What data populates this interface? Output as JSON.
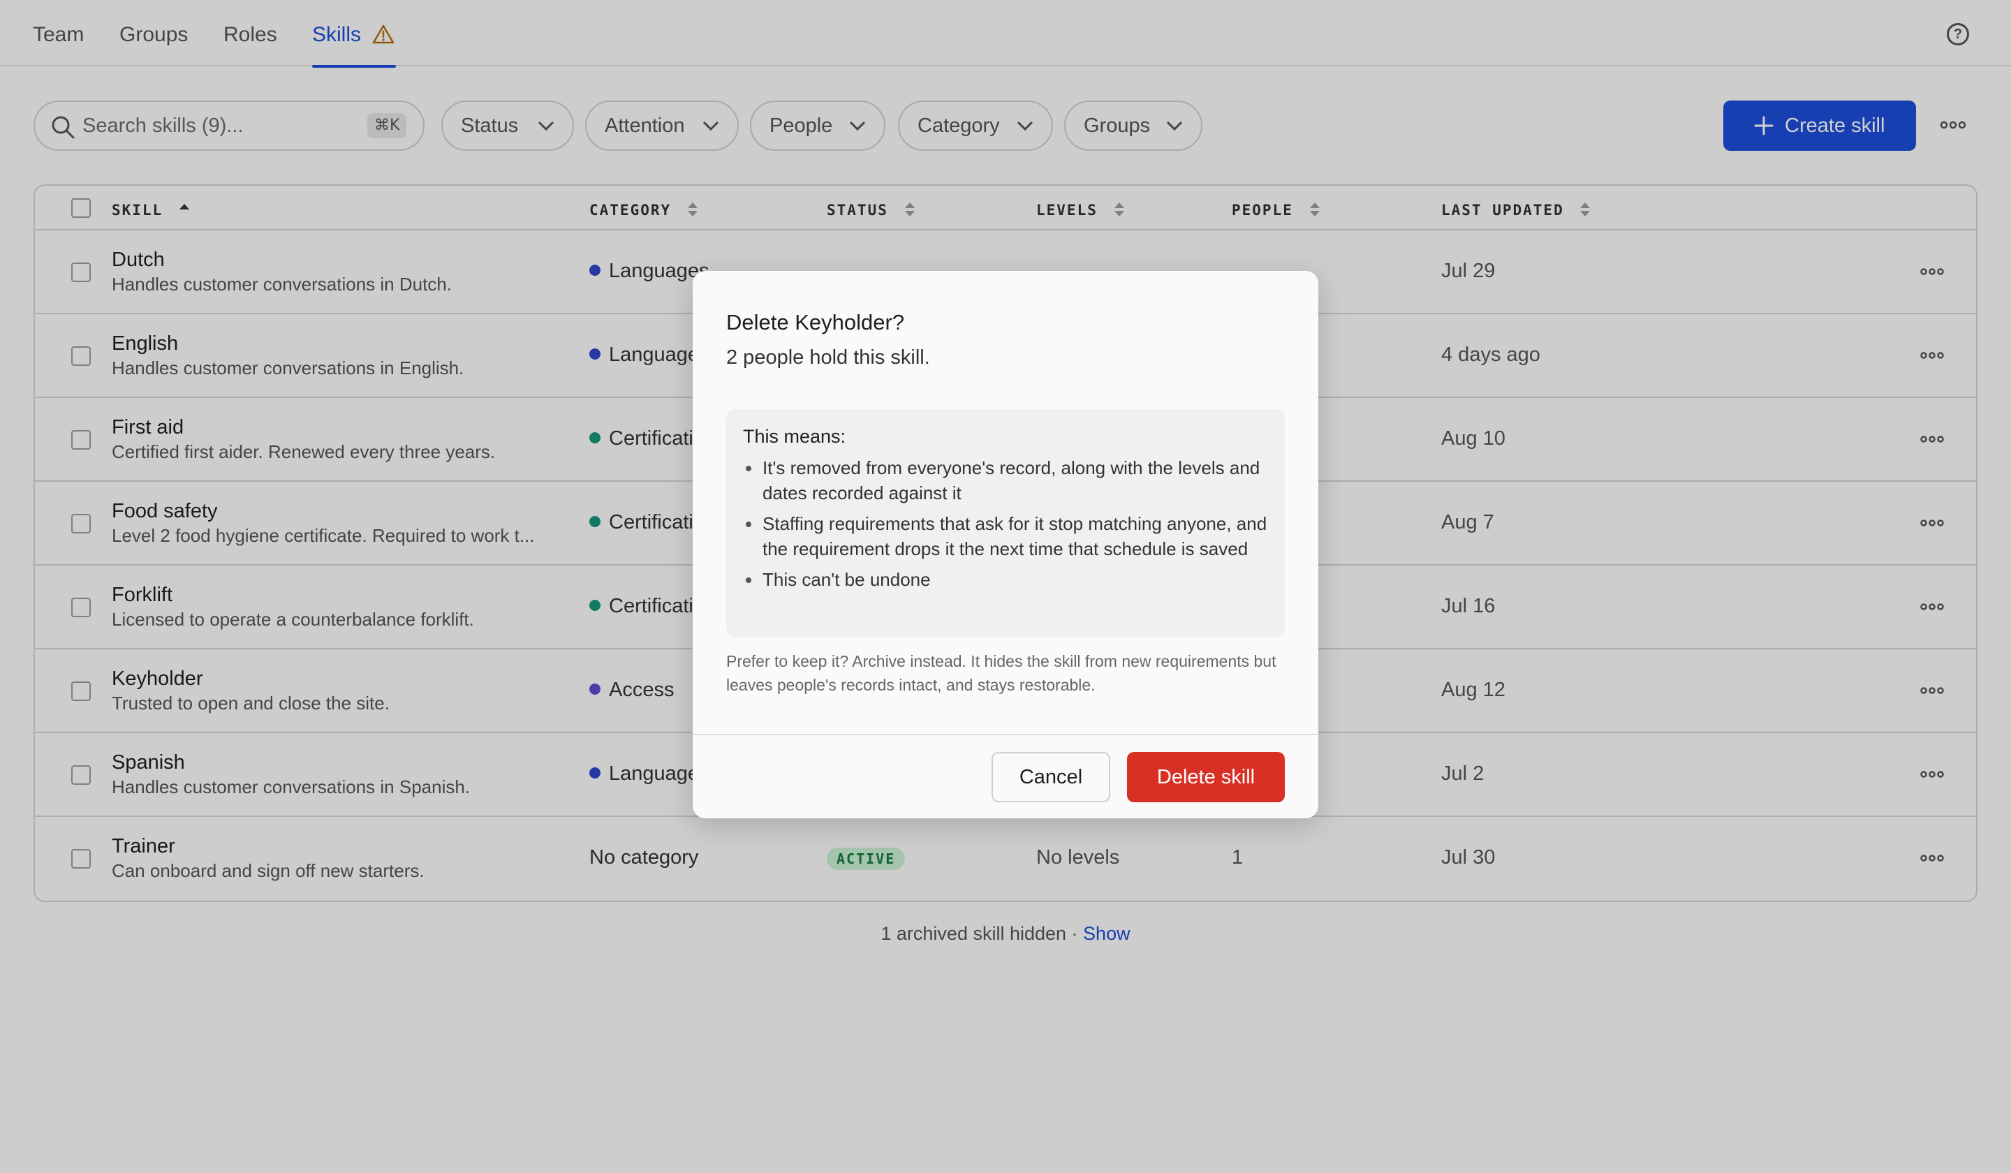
{
  "nav": {
    "tabs": [
      {
        "label": "Team"
      },
      {
        "label": "Groups"
      },
      {
        "label": "Roles"
      },
      {
        "label": "Skills"
      }
    ]
  },
  "toolbar": {
    "search_placeholder": "Search skills (9)...",
    "search_shortcut": "⌘K",
    "filters": [
      "Status",
      "Attention",
      "People",
      "Category",
      "Groups"
    ],
    "create_label": "Create skill"
  },
  "table": {
    "headers": {
      "skill": "SKILL",
      "category": "CATEGORY",
      "status": "STATUS",
      "levels": "LEVELS",
      "people": "PEOPLE",
      "updated": "LAST UPDATED"
    },
    "rows": [
      {
        "name": "Dutch",
        "desc": "Handles customer conversations in Dutch.",
        "category": "Languages",
        "dot": "#2f45c8",
        "updated": "Jul 29"
      },
      {
        "name": "English",
        "desc": "Handles customer conversations in English.",
        "category": "Languages",
        "dot": "#2f45c8",
        "updated": "4 days ago"
      },
      {
        "name": "First aid",
        "desc": "Certified first aider. Renewed every three years.",
        "category": "Certifications",
        "dot": "#16957a",
        "updated": "Aug 10"
      },
      {
        "name": "Food safety",
        "desc": "Level 2 food hygiene certificate. Required to work t...",
        "category": "Certifications",
        "dot": "#16957a",
        "updated": "Aug 7"
      },
      {
        "name": "Forklift",
        "desc": "Licensed to operate a counterbalance forklift.",
        "category": "Certifications",
        "dot": "#16957a",
        "updated": "Jul 16"
      },
      {
        "name": "Keyholder",
        "desc": "Trusted to open and close the site.",
        "category": "Access",
        "dot": "#5b4bd0",
        "updated": "Aug 12"
      },
      {
        "name": "Spanish",
        "desc": "Handles customer conversations in Spanish.",
        "category": "Languages",
        "dot": "#2f45c8",
        "updated": "Jul 2"
      },
      {
        "name": "Trainer",
        "desc": "Can onboard and sign off new starters.",
        "category": "No category",
        "status": "ACTIVE",
        "levels": "No levels",
        "people": "1",
        "updated": "Jul 30"
      }
    ]
  },
  "footer": {
    "hidden_text": "1 archived skill hidden · ",
    "show_label": "Show"
  },
  "modal": {
    "title": "Delete Keyholder?",
    "subtitle": "2 people hold this skill.",
    "means_title": "This means:",
    "bullets": [
      "It's removed from everyone's record, along with the levels and dates recorded against it",
      "Staffing requirements that ask for it stop matching anyone, and the requirement drops it the next time that schedule is saved",
      "This can't be undone"
    ],
    "archive_note": "Prefer to keep it? Archive instead. It hides the skill from new requirements but leaves people's records intact, and stays restorable.",
    "cancel_label": "Cancel",
    "delete_label": "Delete skill"
  },
  "colors": {
    "accent": "#1d4ed8",
    "danger": "#d93025",
    "active_badge_bg": "#c9f0d4",
    "active_badge_fg": "#157a3b"
  }
}
